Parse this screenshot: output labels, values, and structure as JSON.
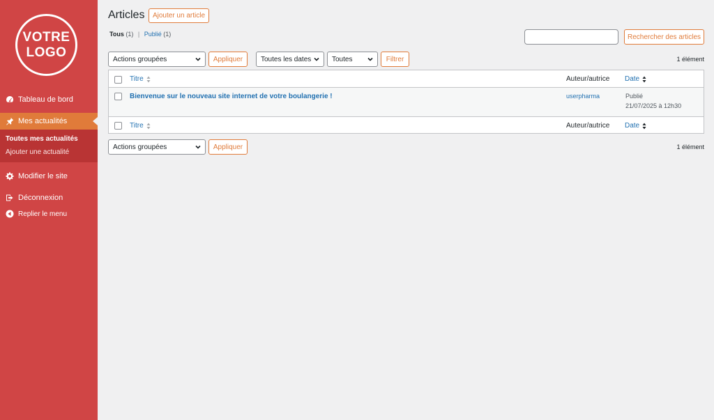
{
  "sidebar": {
    "logo_text": "VOTRE\nLOGO",
    "items": [
      {
        "label": "Tableau de bord",
        "icon": "dashboard-icon"
      },
      {
        "label": "Mes actualités",
        "icon": "pin-icon"
      },
      {
        "label": "Modifier le site",
        "icon": "gear-icon"
      },
      {
        "label": "Déconnexion",
        "icon": "logout-icon"
      },
      {
        "label": "Replier le menu",
        "icon": "collapse-icon"
      }
    ],
    "submenu": [
      {
        "label": "Toutes mes actualités"
      },
      {
        "label": "Ajouter une actualité"
      }
    ]
  },
  "header": {
    "title": "Articles",
    "add_label": "Ajouter un article"
  },
  "filters": {
    "all_label": "Tous",
    "all_count": "(1)",
    "separator": "|",
    "published_label": "Publié",
    "published_count": "(1)"
  },
  "search": {
    "value": "",
    "button_label": "Rechercher des articles"
  },
  "toolbar_top": {
    "bulk_actions": "Actions groupées",
    "apply_label": "Appliquer",
    "dates": "Toutes les dates",
    "categories": "Toutes",
    "filter_label": "Filtrer",
    "count": "1 élément"
  },
  "table": {
    "columns": {
      "title": "Titre",
      "author": "Auteur/autrice",
      "date": "Date"
    },
    "rows": [
      {
        "title": "Bienvenue sur le nouveau site internet de votre boulangerie !",
        "author": "userpharma",
        "status": "Publié",
        "date": "21/07/2025 à 12h30"
      }
    ]
  },
  "toolbar_bottom": {
    "bulk_actions": "Actions groupées",
    "apply_label": "Appliquer",
    "count": "1 élément"
  },
  "colors": {
    "sidebar": "#d04545",
    "sidebar_current": "#e07b3a",
    "submenu": "#b93434",
    "accent": "#e07b3a",
    "link": "#2271b1"
  }
}
